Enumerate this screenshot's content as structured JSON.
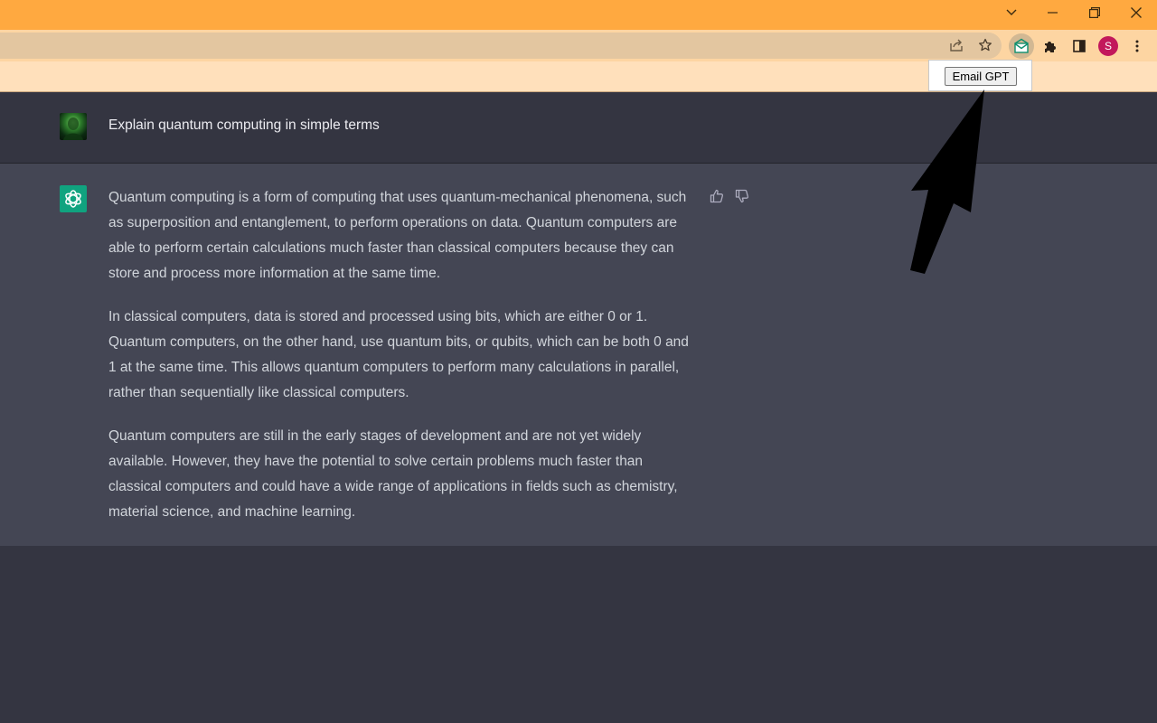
{
  "browser": {
    "window_controls": {
      "tab_search_icon": "chevron-down",
      "minimize_icon": "minimize",
      "restore_icon": "restore",
      "close_icon": "close"
    },
    "toolbar": {
      "share_icon": "share",
      "bookmark_icon": "star",
      "extension_icon": "email-gpt",
      "extensions_icon": "puzzle",
      "side_panel_icon": "side-panel",
      "profile_initial": "S",
      "menu_icon": "three-dots"
    }
  },
  "extension_popup": {
    "button_label": "Email GPT"
  },
  "conversation": {
    "user_message": "Explain quantum computing in simple terms",
    "assistant_paragraphs": [
      "Quantum computing is a form of computing that uses quantum-mechanical phenomena, such as superposition and entanglement, to perform operations on data. Quantum computers are able to perform certain calculations much faster than classical computers because they can store and process more information at the same time.",
      "In classical computers, data is stored and processed using bits, which are either 0 or 1. Quantum computers, on the other hand, use quantum bits, or qubits, which can be both 0 and 1 at the same time. This allows quantum computers to perform many calculations in parallel, rather than sequentially like classical computers.",
      "Quantum computers are still in the early stages of development and are not yet widely available. However, they have the potential to solve certain problems much faster than classical computers and could have a wide range of applications in fields such as chemistry, material science, and machine learning."
    ]
  },
  "colors": {
    "titlebar": "#ffa940",
    "toolbar": "#fdd5a2",
    "omnibox": "#e3c6a0",
    "user_row": "#343541",
    "assistant_row": "#444654",
    "assistant_avatar": "#10a37f",
    "profile_avatar": "#c2185b"
  }
}
